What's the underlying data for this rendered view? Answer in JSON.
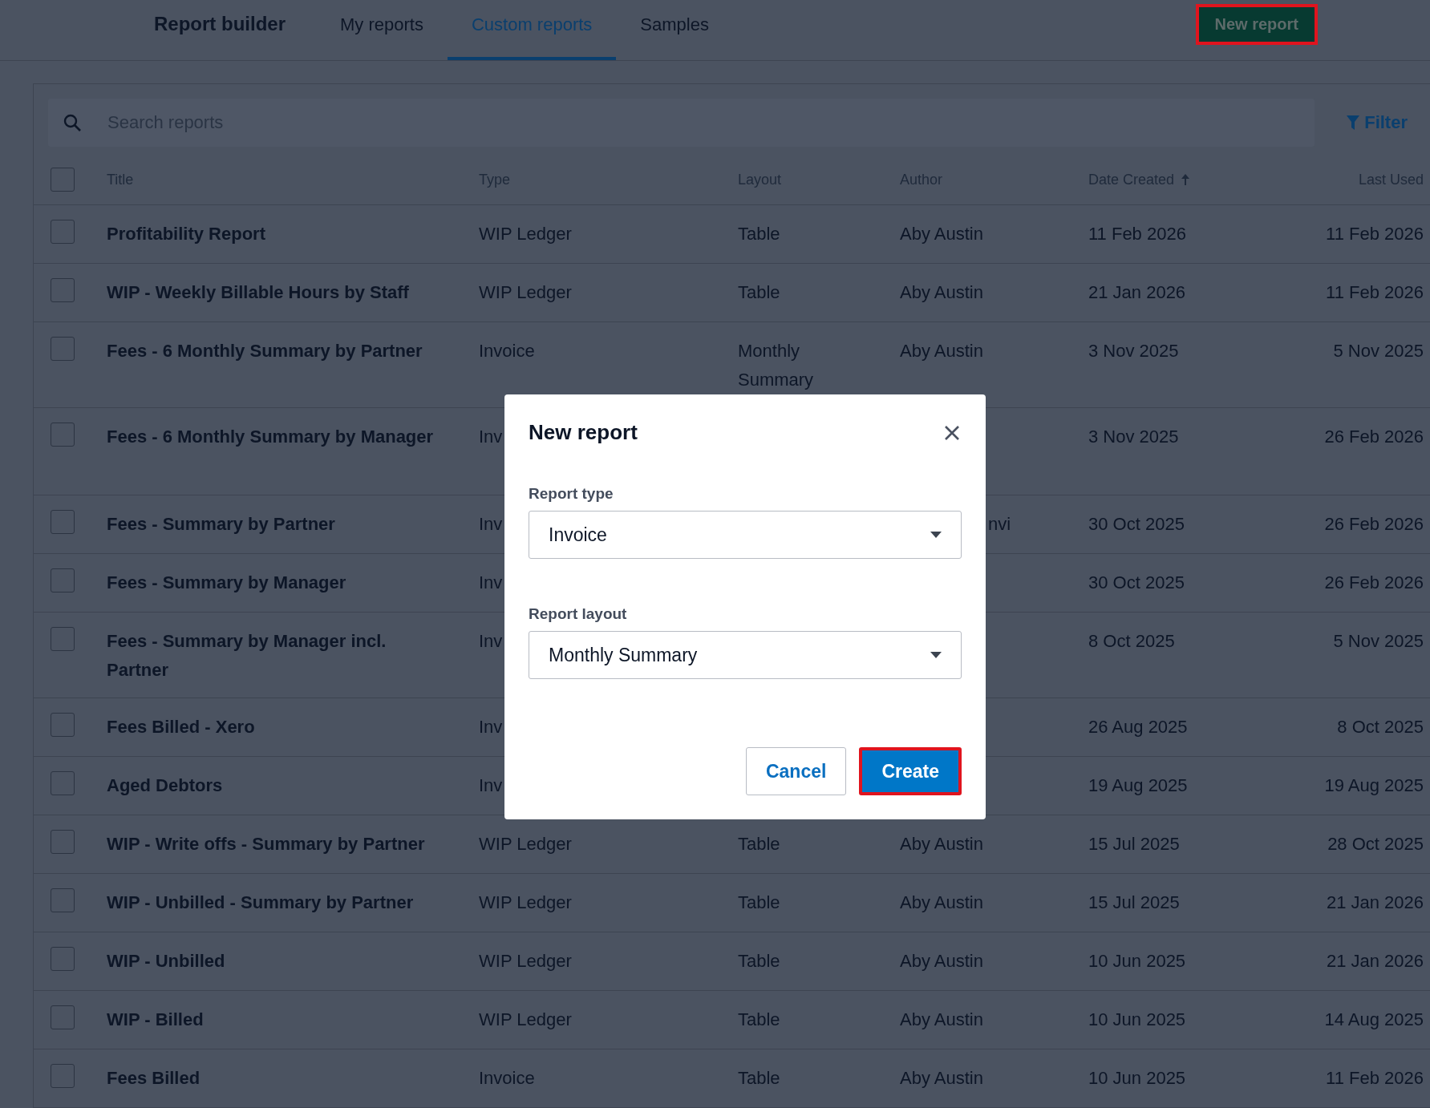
{
  "header": {
    "title": "Report builder",
    "tabs": [
      {
        "label": "My reports",
        "selected": false
      },
      {
        "label": "Custom reports",
        "selected": true
      },
      {
        "label": "Samples",
        "selected": false
      }
    ],
    "new_button": "New report"
  },
  "search": {
    "placeholder": "Search reports"
  },
  "filter": "Filter",
  "table": {
    "select_all": {
      "checked": false
    },
    "columns": [
      {
        "label": "Title",
        "sorted": false
      },
      {
        "label": "Type",
        "sorted": false
      },
      {
        "label": "Layout",
        "sorted": false
      },
      {
        "label": "Author",
        "sorted": false
      },
      {
        "label": "Date Created",
        "sorted": true
      },
      {
        "label": "Last Used",
        "sorted": false
      }
    ],
    "rows": [
      {
        "checked": false,
        "title": "Profitability Report",
        "type": "WIP Ledger",
        "layout": "Table",
        "author": "Aby Austin",
        "created": "11 Feb 2026",
        "last_used": "11 Feb 2026"
      },
      {
        "checked": false,
        "title": "WIP - Weekly Billable Hours by Staff",
        "type": "WIP Ledger",
        "layout": "Table",
        "author": "Aby Austin",
        "created": "21 Jan 2026",
        "last_used": "11 Feb 2026"
      },
      {
        "checked": false,
        "title": "Fees - 6 Monthly Summary by Partner",
        "type": "Invoice",
        "layout": "Monthly Summary",
        "author": "Aby Austin",
        "created": "3 Nov 2025",
        "last_used": "5 Nov 2025"
      },
      {
        "checked": false,
        "kind": "tall",
        "title": "Fees - 6 Monthly Summary by Manager",
        "type": "Inv",
        "created": "3 Nov 2025",
        "last_used": "26 Feb 2026"
      },
      {
        "checked": false,
        "title": "Fees - Summary by Partner",
        "type": "Inv",
        "author_tail": "nvi",
        "created": "30 Oct 2025",
        "last_used": "26 Feb 2026"
      },
      {
        "checked": false,
        "title": "Fees - Summary by Manager",
        "type": "Inv",
        "created": "30 Oct 2025",
        "last_used": "26 Feb 2026"
      },
      {
        "checked": false,
        "title": "Fees - Summary by Manager incl. Partner",
        "type": "Inv",
        "created": "8 Oct 2025",
        "last_used": "5 Nov 2025"
      },
      {
        "checked": false,
        "title": "Fees Billed - Xero",
        "type": "Inv",
        "created": "26 Aug 2025",
        "last_used": "8 Oct 2025"
      },
      {
        "checked": false,
        "title": "Aged Debtors",
        "type": "Inv",
        "created": "19 Aug 2025",
        "last_used": "19 Aug 2025"
      },
      {
        "checked": false,
        "title": "WIP - Write offs - Summary by Partner",
        "type": "WIP Ledger",
        "layout": "Table",
        "author": "Aby Austin",
        "created": "15 Jul 2025",
        "last_used": "28 Oct 2025"
      },
      {
        "checked": false,
        "title": "WIP - Unbilled - Summary by Partner",
        "type": "WIP Ledger",
        "layout": "Table",
        "author": "Aby Austin",
        "created": "15 Jul 2025",
        "last_used": "21 Jan 2026"
      },
      {
        "checked": false,
        "title": "WIP - Unbilled",
        "type": "WIP Ledger",
        "layout": "Table",
        "author": "Aby Austin",
        "created": "10 Jun 2025",
        "last_used": "21 Jan 2026"
      },
      {
        "checked": false,
        "title": "WIP - Billed",
        "type": "WIP Ledger",
        "layout": "Table",
        "author": "Aby Austin",
        "created": "10 Jun 2025",
        "last_used": "14 Aug 2025"
      },
      {
        "checked": false,
        "title": "Fees Billed",
        "type": "Invoice",
        "layout": "Table",
        "author": "Aby Austin",
        "created": "10 Jun 2025",
        "last_used": "11 Feb 2026"
      }
    ]
  },
  "dialog": {
    "title": "New report",
    "fields": [
      {
        "label": "Report type",
        "value": "Invoice"
      },
      {
        "label": "Report layout",
        "value": "Monthly Summary"
      }
    ],
    "buttons": [
      {
        "label": "Cancel",
        "kind": "secondary"
      },
      {
        "label": "Create",
        "kind": "primary"
      }
    ]
  }
}
